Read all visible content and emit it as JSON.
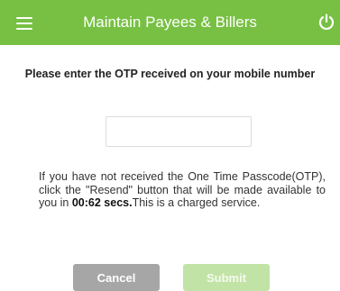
{
  "header": {
    "title": "Maintain Payees & Billers",
    "menu_icon": "hamburger-menu-icon",
    "power_icon": "power-icon",
    "color": "#77c043"
  },
  "otp": {
    "prompt": "Please enter the OTP received on your mobile number",
    "value": "",
    "placeholder": ""
  },
  "info": {
    "text_before": "If you have not received the One Time Passcode(OTP), click the \"Resend\" button that will be made available to you in ",
    "timer": "00:62 secs.",
    "text_after": "This is a charged service."
  },
  "buttons": {
    "cancel_label": "Cancel",
    "submit_label": "Submit",
    "cancel_color": "#a6a6a6",
    "submit_color": "#c2e3a6"
  }
}
